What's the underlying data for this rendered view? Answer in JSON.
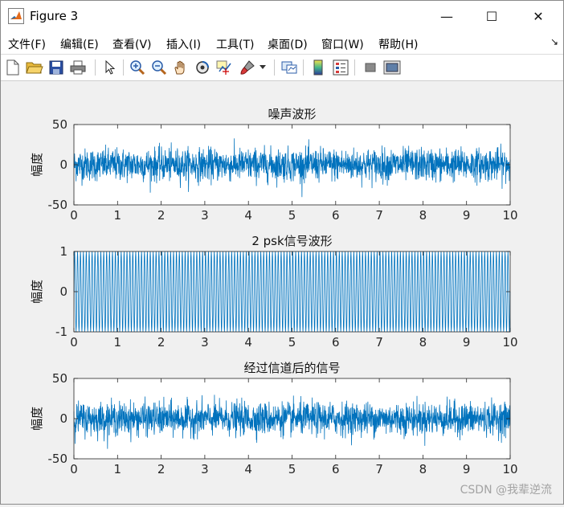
{
  "window": {
    "title": "Figure 3",
    "controls": {
      "minimize": "—",
      "maximize": "☐",
      "close": "✕"
    }
  },
  "menu": {
    "items": [
      "文件(F)",
      "编辑(E)",
      "查看(V)",
      "插入(I)",
      "工具(T)",
      "桌面(D)",
      "窗口(W)",
      "帮助(H)"
    ],
    "dock_arrow": "↘"
  },
  "toolbar": {
    "icons": [
      "new-figure-icon",
      "open-file-icon",
      "save-icon",
      "print-icon",
      "select-arrow-icon",
      "zoom-in-icon",
      "zoom-out-icon",
      "pan-hand-icon",
      "rotate-3d-icon",
      "data-cursor-icon",
      "brush-icon",
      "brush-dropdown-icon",
      "link-plot-icon",
      "colorbar-icon",
      "legend-icon",
      "hide-plot-tools-icon",
      "show-plot-tools-icon"
    ]
  },
  "colors": {
    "line": "#0072bd",
    "axes_bg": "#ffffff",
    "figure_bg": "#f0f0f0"
  },
  "watermark": "CSDN @我辈逆流",
  "chart_data": [
    {
      "type": "line",
      "title": "噪声波形",
      "xlabel": "",
      "ylabel": "幅度",
      "xlim": [
        0,
        10
      ],
      "ylim": [
        -50,
        50
      ],
      "xticks": [
        "0",
        "1",
        "2",
        "3",
        "4",
        "5",
        "6",
        "7",
        "8",
        "9",
        "10"
      ],
      "yticks": [
        "50",
        "0",
        "-50"
      ],
      "grid": false,
      "series": [
        {
          "kind": "gaussian-noise",
          "mean": 0,
          "std": 10,
          "peak_abs": 45,
          "samples": 2000
        }
      ]
    },
    {
      "type": "line",
      "title": "2 psk信号波形",
      "xlabel": "",
      "ylabel": "幅度",
      "xlim": [
        0,
        10
      ],
      "ylim": [
        -1,
        1
      ],
      "xticks": [
        "0",
        "1",
        "2",
        "3",
        "4",
        "5",
        "6",
        "7",
        "8",
        "9",
        "10"
      ],
      "yticks": [
        "1",
        "0",
        "-1"
      ],
      "grid": false,
      "series": [
        {
          "kind": "2psk-carrier",
          "amplitude": 1,
          "carrier_cycles": 150
        }
      ]
    },
    {
      "type": "line",
      "title": "经过信道后的信号",
      "xlabel": "",
      "ylabel": "幅度",
      "xlim": [
        0,
        10
      ],
      "ylim": [
        -50,
        50
      ],
      "xticks": [
        "0",
        "1",
        "2",
        "3",
        "4",
        "5",
        "6",
        "7",
        "8",
        "9",
        "10"
      ],
      "yticks": [
        "50",
        "0",
        "-50"
      ],
      "grid": false,
      "series": [
        {
          "kind": "gaussian-noise",
          "mean": 0,
          "std": 10,
          "peak_abs": 45,
          "samples": 2000
        }
      ]
    }
  ]
}
